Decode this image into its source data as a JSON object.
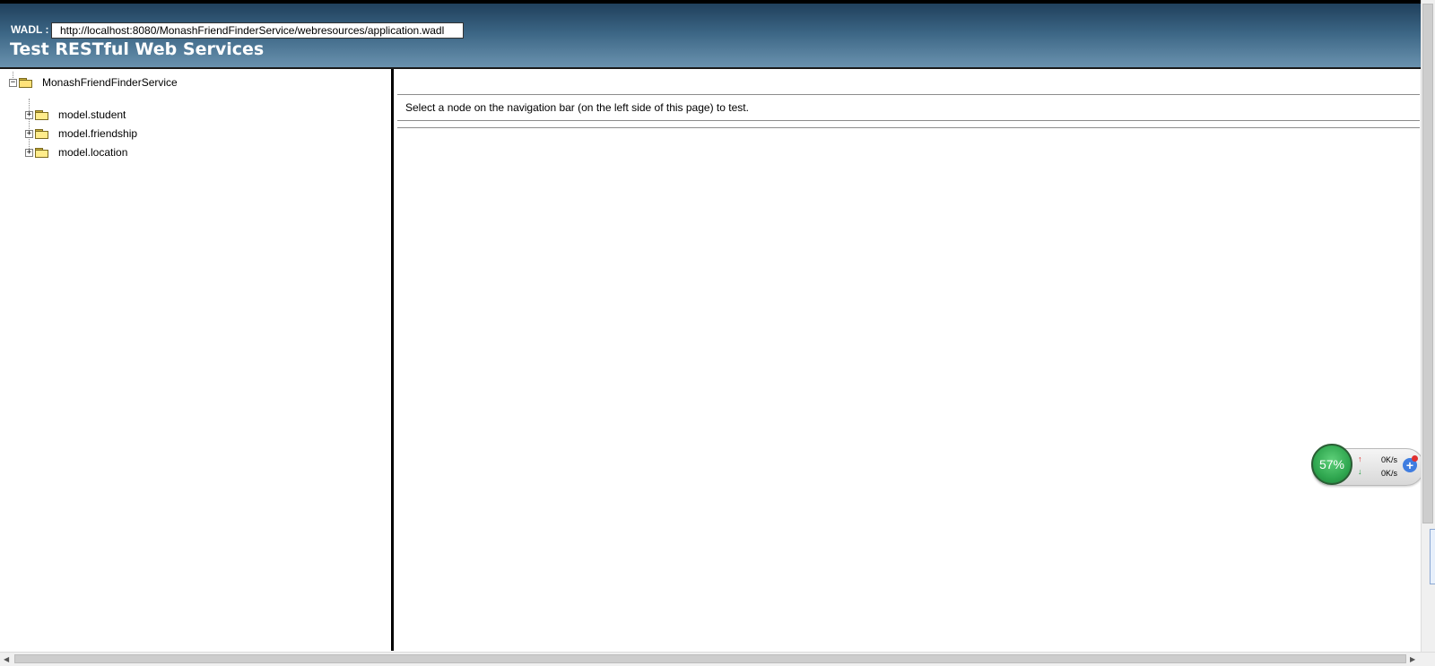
{
  "header": {
    "wadl_label": "WADL :",
    "wadl_url": "http://localhost:8080/MonashFriendFinderService/webresources/application.wadl",
    "title": "Test RESTful Web Services"
  },
  "tree": {
    "root": {
      "label": "MonashFriendFinderService",
      "toggle": "−"
    },
    "items": [
      {
        "label": "model.student",
        "toggle": "+"
      },
      {
        "label": "model.friendship",
        "toggle": "+"
      },
      {
        "label": "model.location",
        "toggle": "+"
      }
    ]
  },
  "main": {
    "message": "Select a node on the navigation bar (on the left side of this page) to test."
  },
  "widget": {
    "percent": "57%",
    "upload_speed": "0K/s",
    "download_speed": "0K/s",
    "up_arrow": "↑",
    "down_arrow": "↓",
    "plus": "+"
  },
  "scrollbars": {
    "left_arrow": "◀",
    "right_arrow": "▶"
  }
}
